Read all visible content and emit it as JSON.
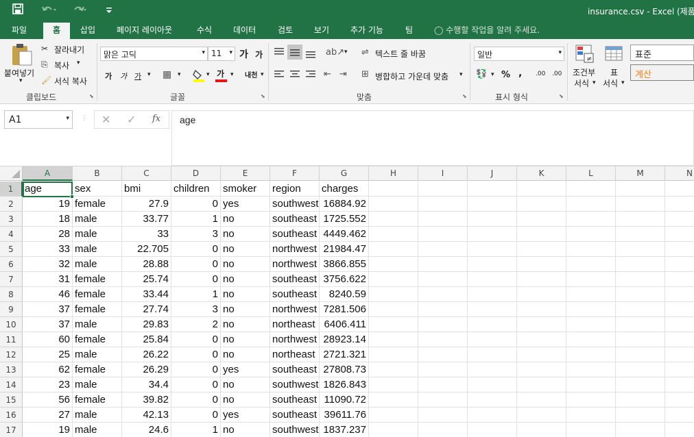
{
  "window": {
    "title": "insurance.csv - Excel (제품 인"
  },
  "quick_access": {
    "save_icon": "save-icon",
    "undo_icon": "undo-icon",
    "redo_icon": "redo-icon",
    "customize_icon": "customize-icon"
  },
  "tabs": [
    "파일",
    "홈",
    "삽입",
    "페이지 레이아웃",
    "수식",
    "데이터",
    "검토",
    "보기",
    "추가 기능",
    "팀"
  ],
  "active_tab": "홈",
  "tell_me": "수행할 작업을 알려 주세요.",
  "clipboard": {
    "paste": "붙여넣기",
    "cut": "잘라내기",
    "copy": "복사",
    "format_painter": "서식 복사",
    "label": "클립보드"
  },
  "font": {
    "name": "맑은 고딕",
    "size": "11",
    "grow": "가",
    "shrink": "가",
    "bold": "가",
    "italic": "가",
    "underline": "가",
    "fill": "",
    "color": "가",
    "phonetic": "내천",
    "label": "글꼴"
  },
  "alignment": {
    "wrap": "텍스트 줄 바꿈",
    "merge": "병합하고 가운데 맞춤",
    "label": "맞춤"
  },
  "number": {
    "format": "일반",
    "percent": "%",
    "comma": ",",
    "inc_decimal": ".00",
    "dec_decimal": ".00",
    "label": "표시 형식"
  },
  "styles": {
    "conditional": "조건부",
    "conditional2": "서식",
    "table": "표",
    "table2": "서식",
    "normal": "표준",
    "calc": "계산"
  },
  "formula_bar": {
    "name_box": "A1",
    "fx": "fx",
    "value": "age"
  },
  "columns": [
    "A",
    "B",
    "C",
    "D",
    "E",
    "F",
    "G",
    "H",
    "I",
    "J",
    "K",
    "L",
    "M",
    "N"
  ],
  "row_numbers": [
    "1",
    "2",
    "3",
    "4",
    "5",
    "6",
    "7",
    "8",
    "9",
    "10",
    "11",
    "12",
    "13",
    "14",
    "15",
    "16",
    "17"
  ],
  "rows": [
    [
      "age",
      "sex",
      "bmi",
      "children",
      "smoker",
      "region",
      "charges"
    ],
    [
      "19",
      "female",
      "27.9",
      "0",
      "yes",
      "southwest",
      "16884.92"
    ],
    [
      "18",
      "male",
      "33.77",
      "1",
      "no",
      "southeast",
      "1725.552"
    ],
    [
      "28",
      "male",
      "33",
      "3",
      "no",
      "southeast",
      "4449.462"
    ],
    [
      "33",
      "male",
      "22.705",
      "0",
      "no",
      "northwest",
      "21984.47"
    ],
    [
      "32",
      "male",
      "28.88",
      "0",
      "no",
      "northwest",
      "3866.855"
    ],
    [
      "31",
      "female",
      "25.74",
      "0",
      "no",
      "southeast",
      "3756.622"
    ],
    [
      "46",
      "female",
      "33.44",
      "1",
      "no",
      "southeast",
      "8240.59"
    ],
    [
      "37",
      "female",
      "27.74",
      "3",
      "no",
      "northwest",
      "7281.506"
    ],
    [
      "37",
      "male",
      "29.83",
      "2",
      "no",
      "northeast",
      "6406.411"
    ],
    [
      "60",
      "female",
      "25.84",
      "0",
      "no",
      "northwest",
      "28923.14"
    ],
    [
      "25",
      "male",
      "26.22",
      "0",
      "no",
      "northeast",
      "2721.321"
    ],
    [
      "62",
      "female",
      "26.29",
      "0",
      "yes",
      "southeast",
      "27808.73"
    ],
    [
      "23",
      "male",
      "34.4",
      "0",
      "no",
      "southwest",
      "1826.843"
    ],
    [
      "56",
      "female",
      "39.82",
      "0",
      "no",
      "southeast",
      "11090.72"
    ],
    [
      "27",
      "male",
      "42.13",
      "0",
      "yes",
      "southeast",
      "39611.76"
    ],
    [
      "19",
      "male",
      "24.6",
      "1",
      "no",
      "southwest",
      "1837.237"
    ]
  ],
  "colors": {
    "excel_green": "#217346",
    "selection": "#217346",
    "calc_text": "#fa7d00"
  }
}
